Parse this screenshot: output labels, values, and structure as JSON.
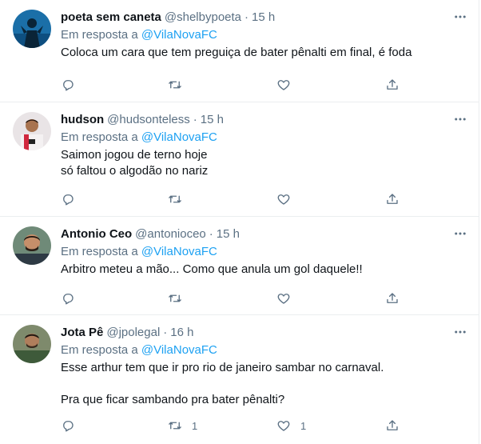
{
  "tweets": [
    {
      "name": "poeta sem caneta",
      "handle": "@shelbypoeta",
      "time": "15 h",
      "reply_prefix": "Em resposta a",
      "reply_to": "@VilaNovaFC",
      "text": "Coloca um cara que tem preguiça de bater pênalti em final, é foda",
      "reply_count": "",
      "retweet_count": "",
      "like_count": ""
    },
    {
      "name": "hudson",
      "handle": "@hudsonteless",
      "time": "15 h",
      "reply_prefix": "Em resposta a",
      "reply_to": "@VilaNovaFC",
      "text": "Saimon jogou de terno hoje\nsó faltou o algodão no nariz",
      "reply_count": "",
      "retweet_count": "",
      "like_count": ""
    },
    {
      "name": "Antonio Ceo",
      "handle": "@antonioceo",
      "time": "15 h",
      "reply_prefix": "Em resposta a",
      "reply_to": "@VilaNovaFC",
      "text": "Arbitro meteu a mão... Como que anula um gol daquele!!",
      "reply_count": "",
      "retweet_count": "",
      "like_count": ""
    },
    {
      "name": "Jota Pê",
      "handle": "@jpolegal",
      "time": "16 h",
      "reply_prefix": "Em resposta a",
      "reply_to": "@VilaNovaFC",
      "text": "Esse arthur tem que ir pro rio de janeiro sambar no carnaval.\n\nPra que ficar sambando pra bater pênalti?",
      "reply_count": "",
      "retweet_count": "1",
      "like_count": "1"
    }
  ],
  "separator": "·",
  "icons": {
    "reply": "reply-icon",
    "retweet": "retweet-icon",
    "like": "heart-icon",
    "share": "share-icon",
    "more": "more-icon"
  },
  "colors": {
    "link": "#1da1f2",
    "secondary_text": "#5b7083",
    "border": "#ebeef0"
  }
}
